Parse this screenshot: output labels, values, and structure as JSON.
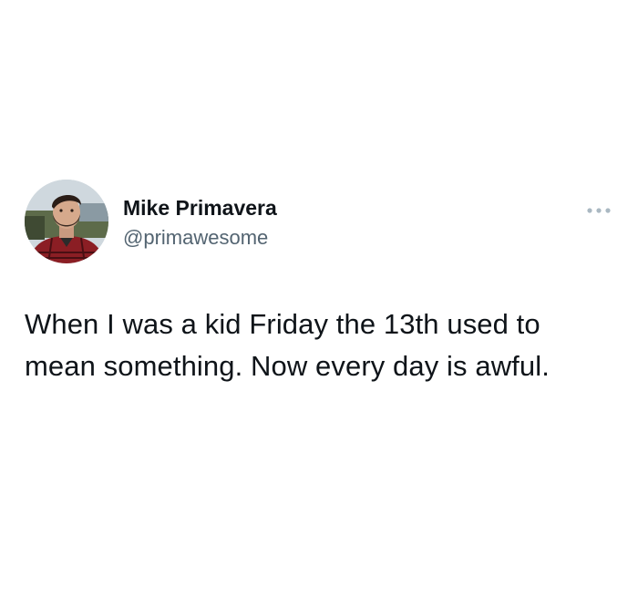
{
  "tweet": {
    "author_name": "Mike Primavera",
    "author_handle": "@primawesome",
    "text": "When I was a kid Friday the 13th used to mean something. Now every day is awful.",
    "more_icon": "more-horizontal-icon",
    "avatar": "profile-photo-bearded-man"
  },
  "colors": {
    "text_primary": "#0f1419",
    "text_secondary": "#536471",
    "more_icon": "#aab8c2",
    "background": "#ffffff"
  }
}
